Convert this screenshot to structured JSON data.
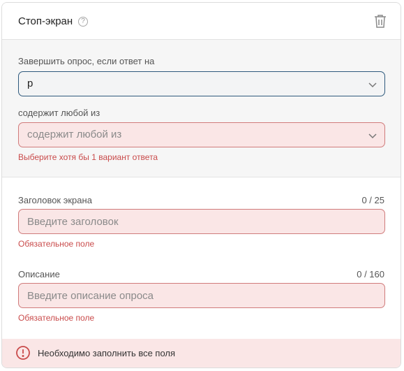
{
  "header": {
    "title": "Стоп-экран",
    "help_icon": "help-circle-icon",
    "delete_icon": "trash-icon"
  },
  "condition": {
    "question_label": "Завершить опрос, если ответ на",
    "question_value": "р",
    "match_label": "содержит любой из",
    "match_placeholder": "содержит любой из",
    "match_error": "Выберите хотя бы 1 вариант ответа"
  },
  "title_field": {
    "label": "Заголовок экрана",
    "counter": "0 / 25",
    "placeholder": "Введите заголовок",
    "error": "Обязательное поле"
  },
  "description_field": {
    "label": "Описание",
    "counter": "0 / 160",
    "placeholder": "Введите описание опроса",
    "error": "Обязательное поле"
  },
  "footer": {
    "message": "Необходимо заполнить все поля",
    "icon": "alert-circle-icon"
  },
  "colors": {
    "error": "#c94b4b",
    "error_bg": "#fae6e6",
    "focus_border": "#2f5a7d"
  }
}
